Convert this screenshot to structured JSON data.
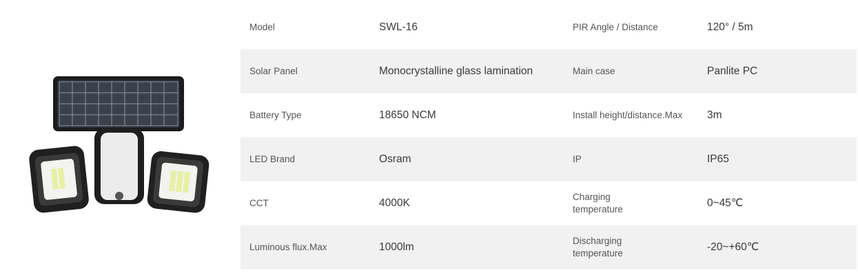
{
  "product": {
    "image_alt": "Solar wall light with solar panel and two LED heads"
  },
  "specs": [
    {
      "label1": "Model",
      "value1": "SWL-16",
      "label2": "PIR Angle / Distance",
      "value2": "120° / 5m"
    },
    {
      "label1": "Solar Panel",
      "value1": "Monocrystalline glass lamination",
      "label2": "Main case",
      "value2": "Panlite PC"
    },
    {
      "label1": "Battery Type",
      "value1": "18650 NCM",
      "label2": "Install height/distance.Max",
      "value2": "3m"
    },
    {
      "label1": "LED Brand",
      "value1": "Osram",
      "label2": "IP",
      "value2": "IP65"
    },
    {
      "label1": "CCT",
      "value1": "4000K",
      "label2": "Charging temperature",
      "value2": "0~45℃"
    },
    {
      "label1": "Luminous flux.Max",
      "value1": "1000lm",
      "label2": "Discharging temperature",
      "value2": "-20~+60℃"
    }
  ]
}
